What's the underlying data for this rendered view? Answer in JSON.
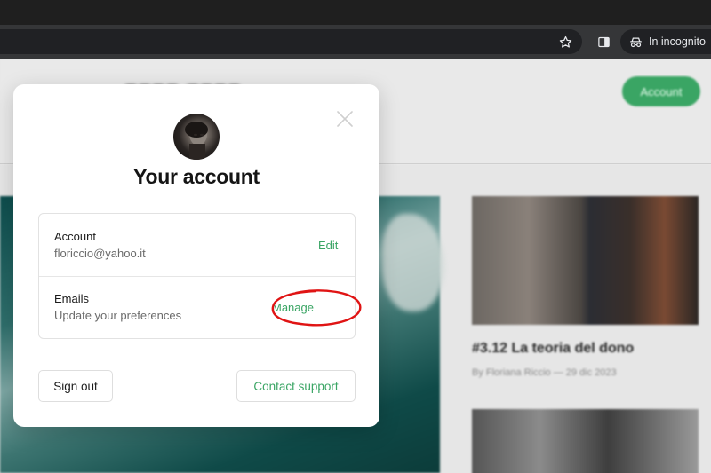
{
  "browser": {
    "incognito_label": "In incognito"
  },
  "page": {
    "header_account_button": "Account",
    "card_title": "#3.12 La teoria del dono",
    "card_byline": "By Floriana Riccio — 29 dic 2023"
  },
  "modal": {
    "title": "Your account",
    "account": {
      "label": "Account",
      "value": "floriccio@yahoo.it",
      "action": "Edit"
    },
    "emails": {
      "label": "Emails",
      "value": "Update your preferences",
      "action": "Manage"
    },
    "sign_out": "Sign out",
    "contact_support": "Contact support"
  },
  "colors": {
    "accent": "#3aa564",
    "annotation": "#e01414"
  }
}
